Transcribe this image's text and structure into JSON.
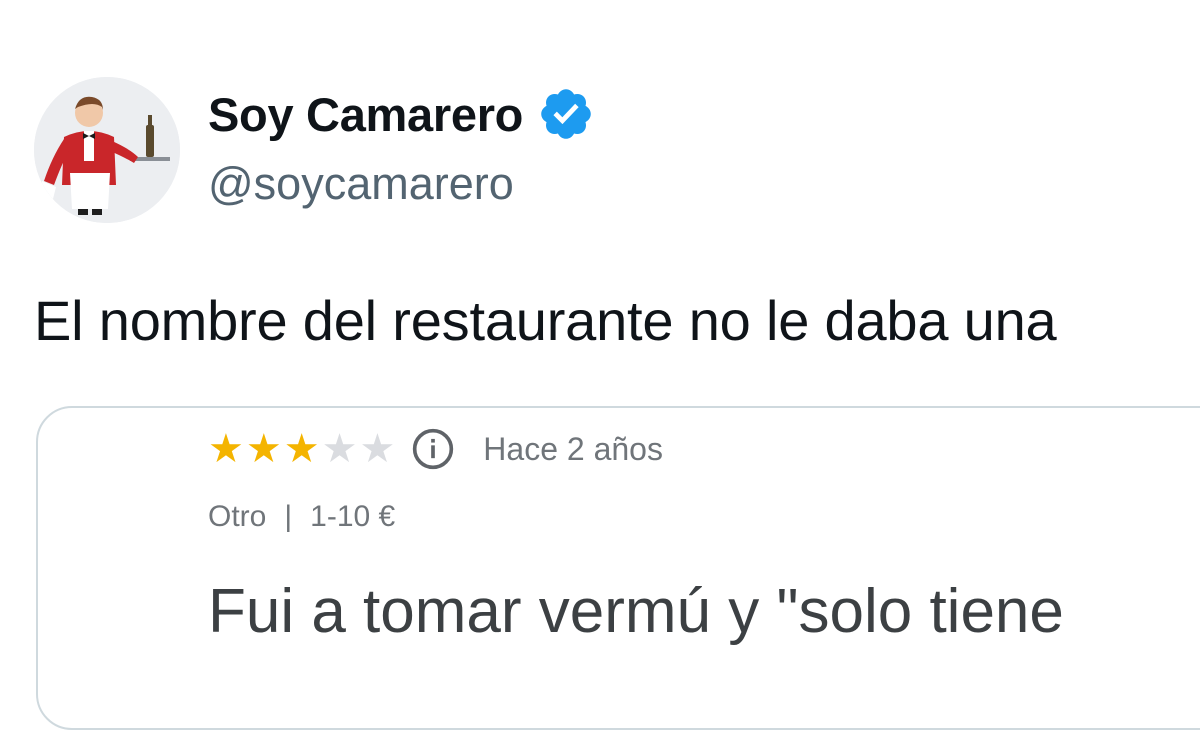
{
  "author": {
    "display_name": "Soy Camarero",
    "handle": "@soycamarero",
    "verified": true,
    "avatar_icon": "waiter-avatar-icon",
    "verified_color": "#1d9bf0"
  },
  "tweet": {
    "text": "El nombre del restaurante no le daba una"
  },
  "quoted_review": {
    "rating": 3,
    "max_rating": 5,
    "star_color": "#f4b400",
    "time": "Hace 2 años",
    "category": "Otro",
    "separator": "|",
    "price_range": "1-10 €",
    "text": "Fui a tomar vermú y \"solo tiene"
  }
}
